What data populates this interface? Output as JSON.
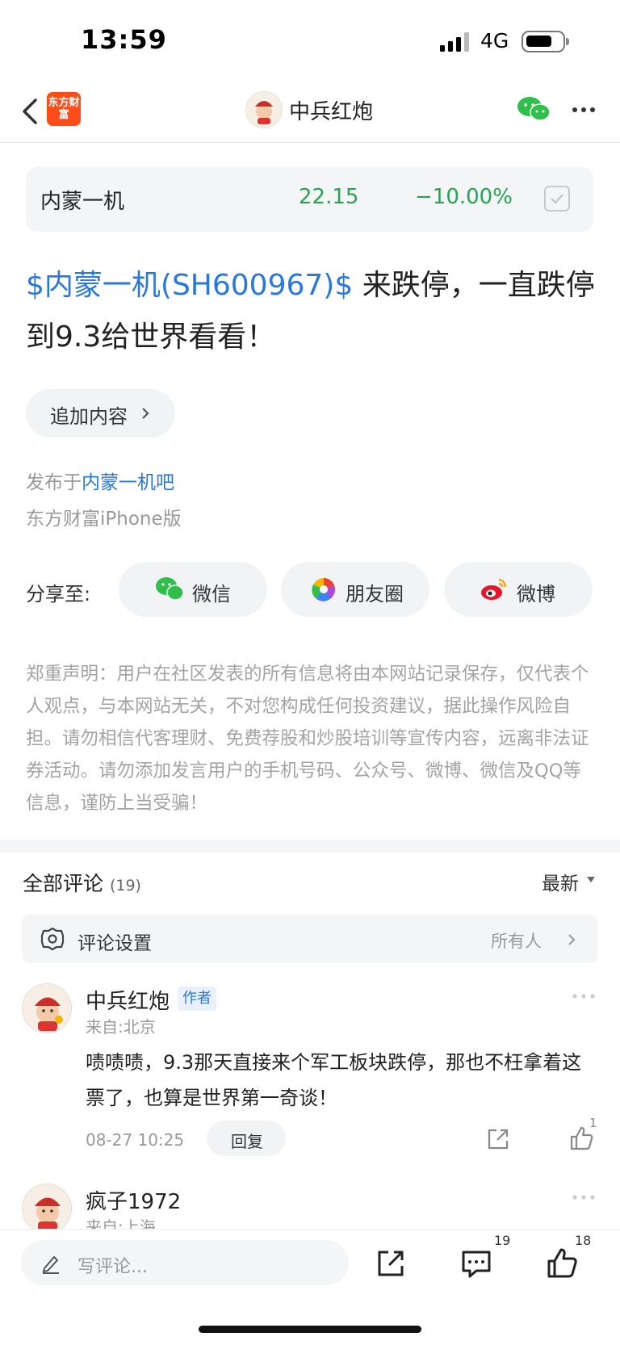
{
  "status": {
    "time": "13:59",
    "network": "4G"
  },
  "nav": {
    "app_logo_text": "东方财富",
    "title": "中兵红炮"
  },
  "stock": {
    "name": "内蒙一机",
    "price": "22.15",
    "change": "−10.00%",
    "color_down": "#26a550"
  },
  "post": {
    "link_text": "$内蒙一机(SH600967)$",
    "text": " 来跌停，一直跌停到9.3给世界看看！",
    "append_label": "追加内容",
    "published_prefix": "发布于",
    "published_link": "内蒙一机吧",
    "source": "东方财富iPhone版"
  },
  "share": {
    "label": "分享至:",
    "wechat": "微信",
    "moments": "朋友圈",
    "weibo": "微博"
  },
  "disclaimer": "郑重声明：用户在社区发表的所有信息将由本网站记录保存，仅代表个人观点，与本网站无关，不对您构成任何投资建议，据此操作风险自担。请勿相信代客理财、免费荐股和炒股培训等宣传内容，远离非法证券活动。请勿添加发言用户的手机号码、公众号、微博、微信及QQ等信息，谨防上当受骗！",
  "comments": {
    "title": "全部评论",
    "count": "(19)",
    "sort": "最新",
    "settings_label": "评论设置",
    "settings_value": "所有人",
    "items": [
      {
        "author": "中兵红炮",
        "tag": "作者",
        "location": "来自:北京",
        "text": "啧啧啧，9.3那天直接来个军工板块跌停，那也不枉拿着这票了，也算是世界第一奇谈！",
        "time": "08-27 10:25",
        "reply": "回复",
        "likes": "1"
      },
      {
        "author": "疯子1972",
        "location": "来自:上海"
      }
    ]
  },
  "bottom": {
    "placeholder": "写评论...",
    "comment_count": "19",
    "like_count": "18"
  },
  "colors": {
    "accent": "#2a78d9",
    "brand": "#ff4d1a",
    "stock_down": "#26a550"
  }
}
